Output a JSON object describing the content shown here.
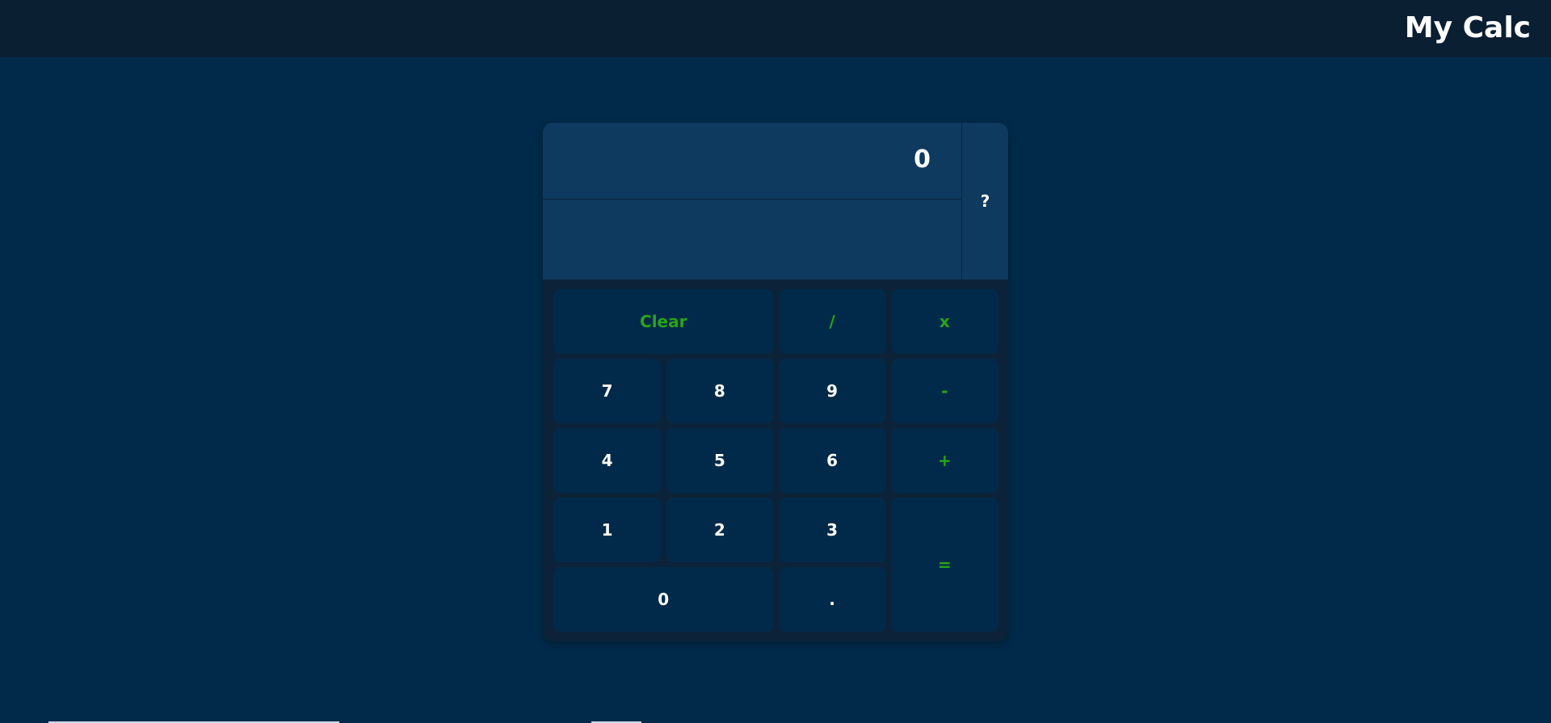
{
  "header": {
    "app_title": "My Calc"
  },
  "display": {
    "value": "0",
    "secondary": "",
    "help_label": "?"
  },
  "keys": {
    "clear": "Clear",
    "divide": "/",
    "multiply": "x",
    "seven": "7",
    "eight": "8",
    "nine": "9",
    "subtract": "-",
    "four": "4",
    "five": "5",
    "six": "6",
    "add": "+",
    "one": "1",
    "two": "2",
    "three": "3",
    "equals": "=",
    "zero": "0",
    "decimal": "."
  },
  "colors": {
    "background": "#012a4a",
    "header_background": "#0b1f33",
    "display_background": "#0f3a5f",
    "keypad_background": "#0c2238",
    "key_background": "#012a4a",
    "operator_text": "#27a41a",
    "digit_text": "#ffffff"
  }
}
